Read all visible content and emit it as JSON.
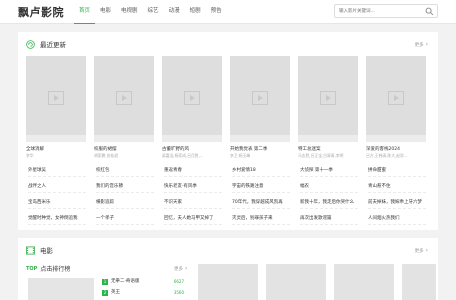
{
  "header": {
    "logo": "飘卢影院",
    "nav": [
      "首页",
      "电影",
      "电视剧",
      "综艺",
      "动漫",
      "短剧",
      "预告"
    ],
    "active_nav": 0,
    "search_placeholder": "输入影片关键词..."
  },
  "recent": {
    "title": "最近更新",
    "more": "更多",
    "cards": [
      {
        "title": "全球消解",
        "sub": "李华"
      },
      {
        "title": "校服的裙摆",
        "sub": "胡家鹏,张桂斌"
      },
      {
        "title": "古董旷野的风",
        "sub": "梁嘉浩,杨家成,吕月胜,..."
      },
      {
        "title": "开始我觉表 第二季",
        "sub": "李卫,杨玉峰"
      },
      {
        "title": "特工总迷案",
        "sub": "马志胜,吕正宝,白翠青,李明"
      },
      {
        "title": "深爱的客栈2024",
        "sub": "吕方,王韩清,陈大,赵欣..."
      }
    ],
    "rows": [
      [
        "外星球吴",
        "校红包",
        "重返青春",
        "乡村爱情18",
        "大侦探 第十一季",
        "拼命甜蜜"
      ],
      [
        "战伴之人",
        "我们的音乐節",
        "快乐老友·有风季",
        "宇宙的铁路注意",
        "幅农",
        "青山惹不住"
      ],
      [
        "宝岛西米乐",
        "横影追踪",
        "不识天家",
        "70年代，我穿越成风凯再",
        "新我十年，我走后你哭什么",
        "前夫掉妹，我嫁乖上牙六梦"
      ],
      [
        "觉醒时种觉，女神倒追我",
        "一个孝子",
        "回忆，夫人她马甲又掉了",
        "灭灵后，别罪孩子来",
        "再次出发歌谣篇",
        "人间烟火热我们"
      ]
    ]
  },
  "movie": {
    "title": "电影",
    "more": "更多",
    "rank_tag": "TOP",
    "rank_title": "点击排行榜",
    "rank_more": "更多",
    "rank_items": [
      {
        "no": "1",
        "name": "无拳二·奇语版",
        "score": "6627"
      },
      {
        "no": "2",
        "name": "英王",
        "score": "3560"
      }
    ]
  }
}
